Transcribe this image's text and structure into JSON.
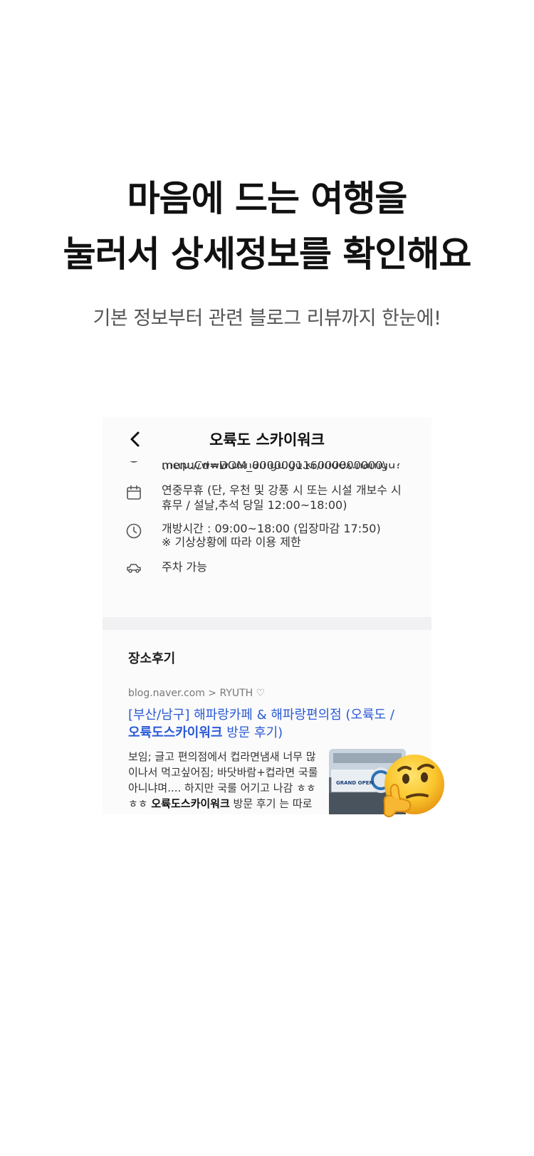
{
  "headline": {
    "line1": "마음에 드는 여행을",
    "line2": "눌러서 상세정보를 확인해요"
  },
  "subheadline": "기본 정보부터 관련 블로그 리뷰까지 한눈에!",
  "screen": {
    "nav": {
      "title": "오륙도 스카이워크"
    },
    "info": {
      "url_partial": "(http://www.bsnamgu.go.kr/index.namgu?",
      "url_line2": "menuCd=DOM_000000116000000000\\",
      "holiday": "연중무휴 (단, 우천 및 강풍 시 또는 시설 개보수 시 휴무 / 설날,추석 당일 12:00~18:00)",
      "hours_line1": "개방시간 : 09:00~18:00 (입장마감 17:50)",
      "hours_line2": "※ 기상상황에 따라 이용 제한",
      "parking": "주차 가능"
    },
    "reviews": {
      "section_title": "장소후기",
      "source": "blog.naver.com > RYUTH ♡",
      "title_part1": "[부산/남구] 해파랑카페 & 해파랑편의점 (오륙도 /",
      "title_bold": "오륙도스카이워크",
      "title_part2": " 방문 후기)",
      "snippet_part1": "보임;     글고 편의점에서 컵라면냄새 너무 많이나서 먹고싶어짐;     바닷바람+컵라면 국룰아니냐며.... 하지만 국룰 어기고 나감 ㅎㅎㅎㅎ     ",
      "snippet_bold": "오륙도스카이워크",
      "snippet_part2": " 방문 후기 는 따로 포스팅을 해 두었다 [부산/남구]",
      "thumbnail_banner": "GRAND OPEN"
    }
  },
  "colors": {
    "link": "#2a5ad6",
    "emoji": "#f7c325"
  }
}
